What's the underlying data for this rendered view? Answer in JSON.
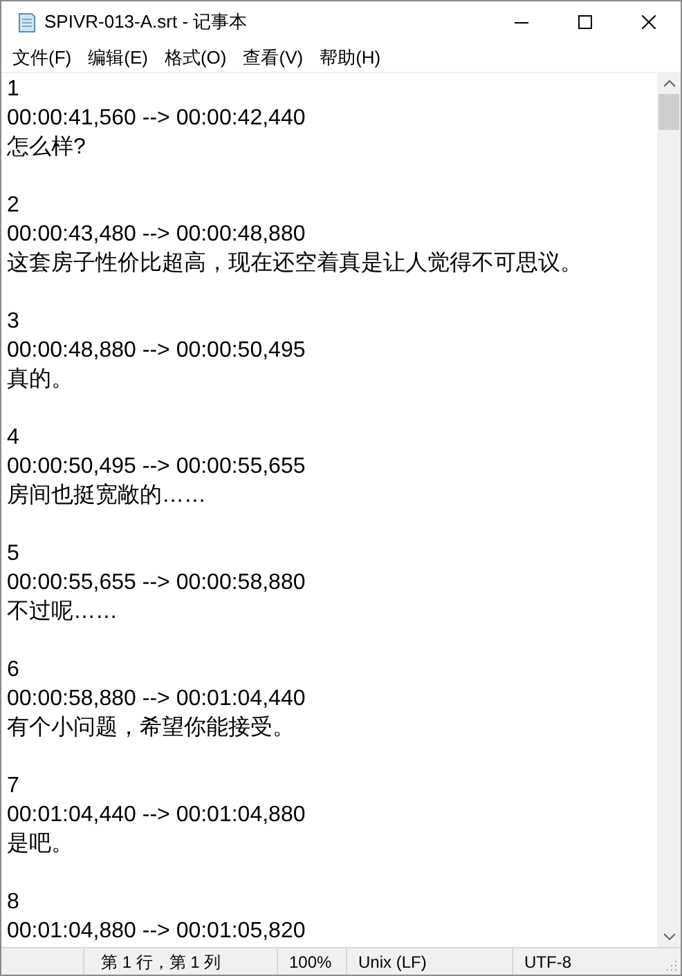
{
  "window": {
    "title": "SPIVR-013-A.srt - 记事本"
  },
  "menu": [
    "文件(F)",
    "编辑(E)",
    "格式(O)",
    "查看(V)",
    "帮助(H)"
  ],
  "subtitles": [
    {
      "index": "1",
      "time": "00:00:41,560 --> 00:00:42,440",
      "text": "怎么样?"
    },
    {
      "index": "2",
      "time": "00:00:43,480 --> 00:00:48,880",
      "text": "这套房子性价比超高，现在还空着真是让人觉得不可思议。"
    },
    {
      "index": "3",
      "time": "00:00:48,880 --> 00:00:50,495",
      "text": "真的。"
    },
    {
      "index": "4",
      "time": "00:00:50,495 --> 00:00:55,655",
      "text": "房间也挺宽敞的……"
    },
    {
      "index": "5",
      "time": "00:00:55,655 --> 00:00:58,880",
      "text": "不过呢……"
    },
    {
      "index": "6",
      "time": "00:00:58,880 --> 00:01:04,440",
      "text": "有个小问题，希望你能接受。"
    },
    {
      "index": "7",
      "time": "00:01:04,440 --> 00:01:04,880",
      "text": "是吧。"
    },
    {
      "index": "8",
      "time": "00:01:04,880 --> 00:01:05,820"
    }
  ],
  "status_bar": {
    "position": "第 1 行，第 1 列",
    "zoom": "100%",
    "line_ending": "Unix (LF)",
    "encoding": "UTF-8"
  }
}
